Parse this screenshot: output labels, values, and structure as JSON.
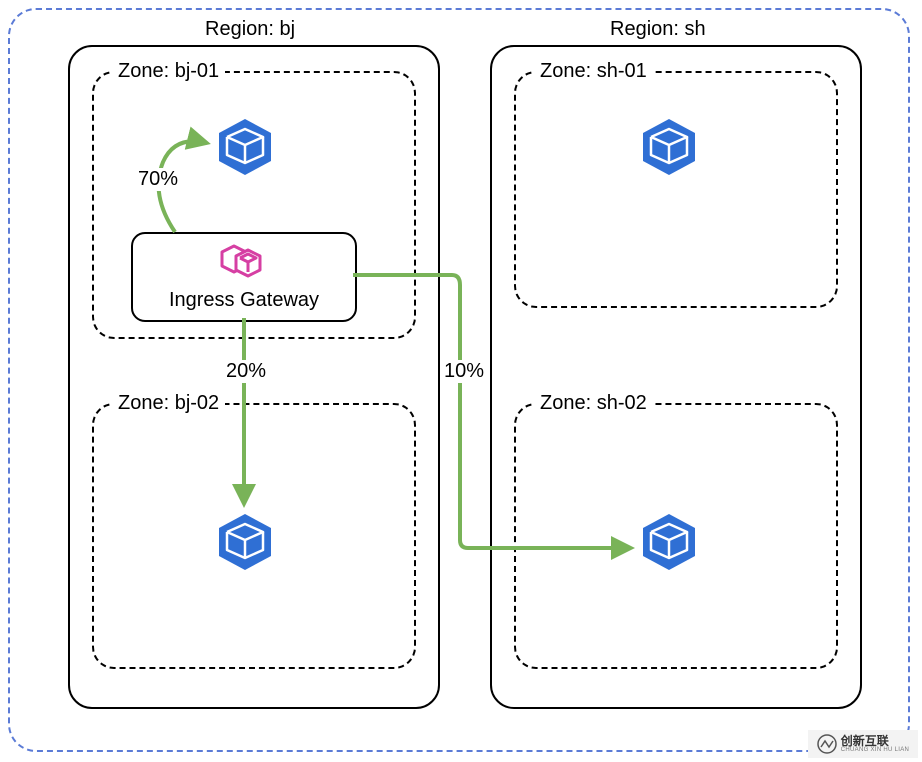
{
  "diagram": {
    "outer_container": "cluster-boundary",
    "regions": [
      {
        "id": "bj",
        "label": "Region: bj",
        "zones": [
          {
            "id": "bj-01",
            "label": "Zone: bj-01",
            "contains_gateway": true,
            "has_service": true
          },
          {
            "id": "bj-02",
            "label": "Zone: bj-02",
            "contains_gateway": false,
            "has_service": true
          }
        ]
      },
      {
        "id": "sh",
        "label": "Region: sh",
        "zones": [
          {
            "id": "sh-01",
            "label": "Zone: sh-01",
            "contains_gateway": false,
            "has_service": true
          },
          {
            "id": "sh-02",
            "label": "Zone: sh-02",
            "contains_gateway": false,
            "has_service": true
          }
        ]
      }
    ],
    "gateway": {
      "label": "Ingress Gateway"
    },
    "traffic_splits": [
      {
        "from": "gateway",
        "to": "bj-01",
        "pct_label": "70%",
        "pct": 70
      },
      {
        "from": "gateway",
        "to": "bj-02",
        "pct_label": "20%",
        "pct": 20
      },
      {
        "from": "gateway",
        "to": "sh-02",
        "pct_label": "10%",
        "pct": 10
      }
    ],
    "colors": {
      "arrow": "#79b358",
      "outer_dash": "#5b7bd6",
      "cube": "#2f6fd4",
      "gateway_icon": "#d63fa3"
    }
  },
  "watermark": {
    "brand_big": "创新互联",
    "brand_small": "CHUANG XIN HU LIAN"
  }
}
